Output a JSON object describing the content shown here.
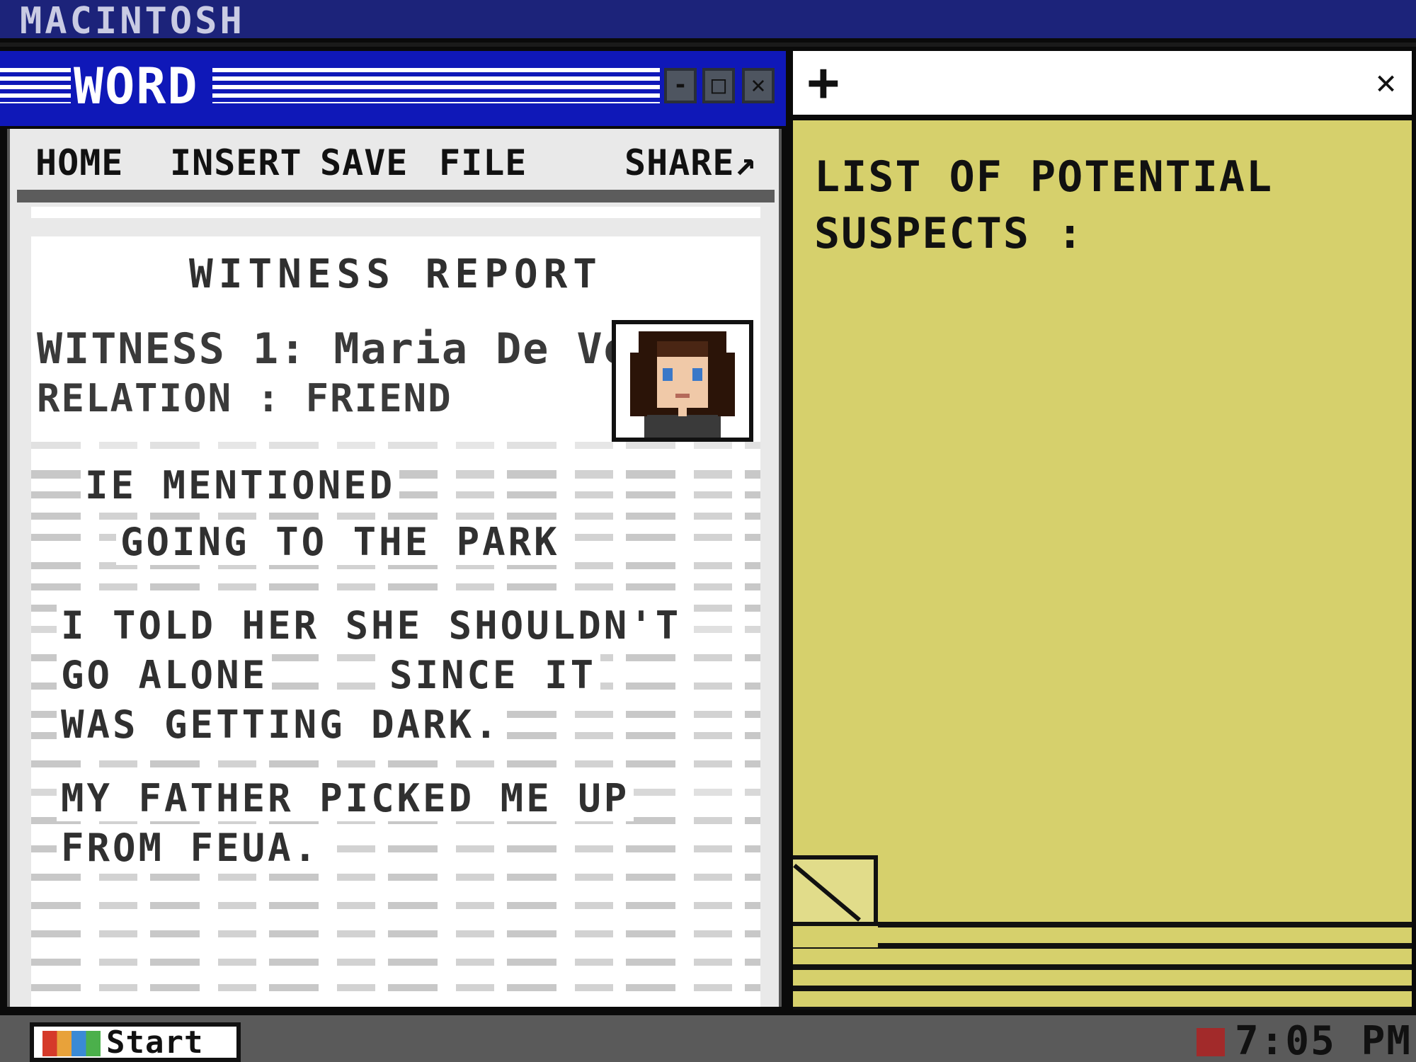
{
  "system": {
    "title": "MACINTOSH"
  },
  "word_window": {
    "title": "WORD",
    "controls": {
      "minimize": "-",
      "maximize": "□",
      "close": "✕"
    },
    "menu": {
      "home": "HOME",
      "insert": "INSERT",
      "save": "SAVE",
      "file": "FILE",
      "share": "SHARE↗"
    },
    "document": {
      "title": "WITNESS REPORT",
      "witness_line": "WITNESS 1: Maria De Vera",
      "relation_line": "RELATION : FRIEND",
      "statements": [
        "IE MENTIONED",
        "GOING TO THE PARK",
        "I TOLD HER SHE SHOULDN'T",
        "GO ALONE",
        "SINCE IT",
        "WAS GETTING DARK.",
        "MY FATHER PICKED ME UP",
        "FROM FEUA."
      ]
    }
  },
  "sticky_note": {
    "add_icon": "+",
    "close_icon": "✕",
    "text": "LIST OF POTENTIAL SUSPECTS :",
    "color": "#d6d06c"
  },
  "taskbar": {
    "start_label": "Start",
    "clock": "7:05 PM"
  },
  "colors": {
    "system_bar": "#1c237a",
    "word_titlebar": "#0f18b8",
    "note": "#d6d06c",
    "taskbar": "#5a5a5a"
  }
}
